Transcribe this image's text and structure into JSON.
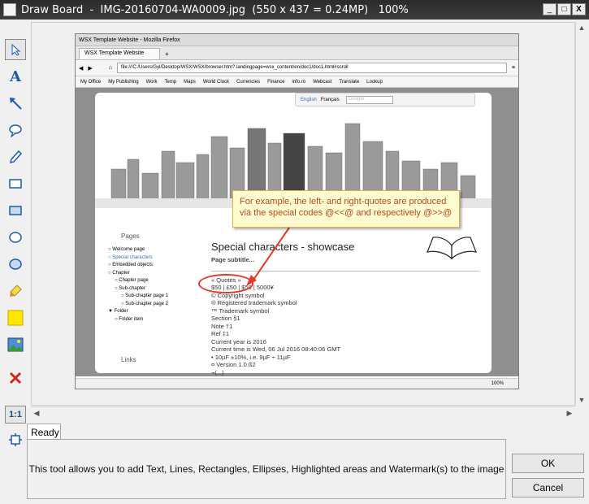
{
  "window": {
    "title": "Draw Board  -  IMG-20160704-WA0009.jpg  (550 x 437 = 0.24MP)   100%",
    "controls": {
      "minimize": "_",
      "maximize": "□",
      "close": "X"
    }
  },
  "toolbar": {
    "tools": [
      "select-icon",
      "text-icon",
      "arrow-icon",
      "ellipse-callout-icon",
      "pencil-icon",
      "rectangle-outline-icon",
      "rectangle-icon",
      "ellipse-outline-icon",
      "ellipse-icon",
      "highlighter-icon",
      "fill-color-icon",
      "watermark-image-icon",
      "delete-icon"
    ],
    "zoom_label": "1:1",
    "text_label": "A"
  },
  "screenshot": {
    "firefox_title": "WSX Template Website - Mozilla Firefox",
    "tab_label": "WSX Template Website",
    "tab_plus": "+",
    "url": "file:///C:/Users/Gyl/Desktop/WSX/WSX/browser.htm?.landingpage=wsx_content/en/doc1/doc1.html#scroll",
    "bookmarks": [
      "My Office",
      "My Publishing",
      "Work",
      "Temp",
      "Maps",
      "World Clock",
      "Currencies",
      "Finance",
      "info.ro",
      "Webcast",
      "Translate",
      "Lookup"
    ],
    "lang": {
      "english": "English",
      "french": "Français",
      "search_placeholder": "Google"
    },
    "sidebar": {
      "pages_heading": "Pages",
      "links_heading": "Links",
      "items": [
        "○ Welcome page",
        "○ Special characters",
        "○ Embedded objects",
        "○ Chapter",
        "○ Chapter page",
        "○ Sub-chapter",
        "○ Sub-chapter page 1",
        "○ Sub-chapter page 2",
        "▼ Folder",
        "○ Folder item"
      ]
    },
    "content": {
      "heading": "Special characters - showcase",
      "subtitle": "Page subtitle...",
      "lines": [
        "« Quotes »",
        "$50 | £50 | $50 | 5000¥",
        "© Copyright symbol",
        "® Registered trademark symbol",
        "™ Trademark symbol",
        "Section §1",
        "Note †1",
        "Ref ‡1",
        "Current year is 2016",
        "Current time is Wed, 06 Jul 2016 08:40:06 GMT",
        "• 10µF ±10%, i.e. 9µF ÷ 11µF",
        "¤ Version 1.0 ß2",
        "¬(...)"
      ]
    },
    "status_zoom": "100%"
  },
  "annotation": {
    "callout_text": "For example, the left- and right-quotes are produced via the special codes @<<@ and respectively @>>@",
    "border_color": "#e3b23c",
    "text_color": "#b44a1d",
    "ellipse_color": "#e23b2e"
  },
  "status": {
    "tab_label": "Ready",
    "message": "This tool allows you to add Text, Lines, Rectangles, Ellipses, Highlighted areas and Watermark(s) to the image"
  },
  "buttons": {
    "ok": "OK",
    "cancel": "Cancel"
  }
}
